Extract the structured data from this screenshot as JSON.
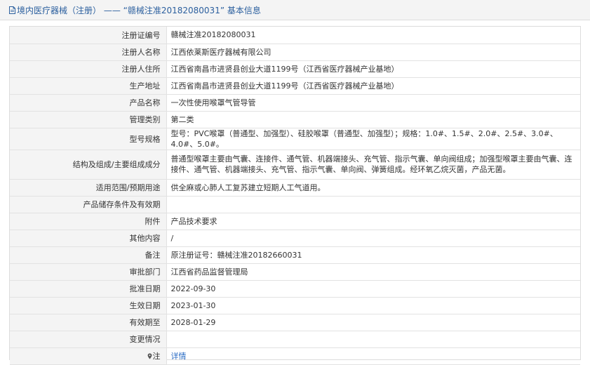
{
  "header": {
    "title": "境内医疗器械（注册） —— “赣械注准20182080031” 基本信息"
  },
  "rows": [
    {
      "label": "注册证编号",
      "value": "赣械注准20182080031"
    },
    {
      "label": "注册人名称",
      "value": "江西依莱斯医疗器械有限公司"
    },
    {
      "label": "注册人住所",
      "value": "江西省南昌市进贤县创业大道1199号（江西省医疗器械产业基地）"
    },
    {
      "label": "生产地址",
      "value": "江西省南昌市进贤县创业大道1199号（江西省医疗器械产业基地）"
    },
    {
      "label": "产品名称",
      "value": "一次性使用喉罩气管导管"
    },
    {
      "label": "管理类别",
      "value": "第二类"
    },
    {
      "label": "型号规格",
      "value": "型号：PVC喉罩（普通型、加强型）、硅胶喉罩（普通型、加强型）；规格：1.0#、1.5#、2.0#、2.5#、3.0#、4.0#、5.0#。"
    },
    {
      "label": "结构及组成/主要组成成分",
      "value": "普通型喉罩主要由气囊、连接件、通气管、机器端接头、充气管、指示气囊、单向阀组成；加强型喉罩主要由气囊、连接件、通气管、机器端接头、充气管、指示气囊、单向阀、弹簧组成。经环氧乙烷灭菌，产品无菌。"
    },
    {
      "label": "适用范围/预期用途",
      "value": "供全麻或心肺人工复苏建立短期人工气道用。"
    },
    {
      "label": "产品储存条件及有效期",
      "value": ""
    },
    {
      "label": "附件",
      "value": "产品技术要求"
    },
    {
      "label": "其他内容",
      "value": "/"
    },
    {
      "label": "备注",
      "value": "原注册证号：赣械注准20182660031"
    },
    {
      "label": "审批部门",
      "value": "江西省药品监督管理局"
    },
    {
      "label": "批准日期",
      "value": "2022-09-30"
    },
    {
      "label": "生效日期",
      "value": "2023-01-30"
    },
    {
      "label": "有效期至",
      "value": "2028-01-29"
    },
    {
      "label": "变更情况",
      "value": ""
    }
  ],
  "footer_row": {
    "label": "注",
    "link_text": "详情"
  },
  "colors": {
    "title": "#2b5f9e",
    "link": "#2b6cc4",
    "label_bg": "#f4f4f4",
    "border": "#e2e2e2"
  }
}
